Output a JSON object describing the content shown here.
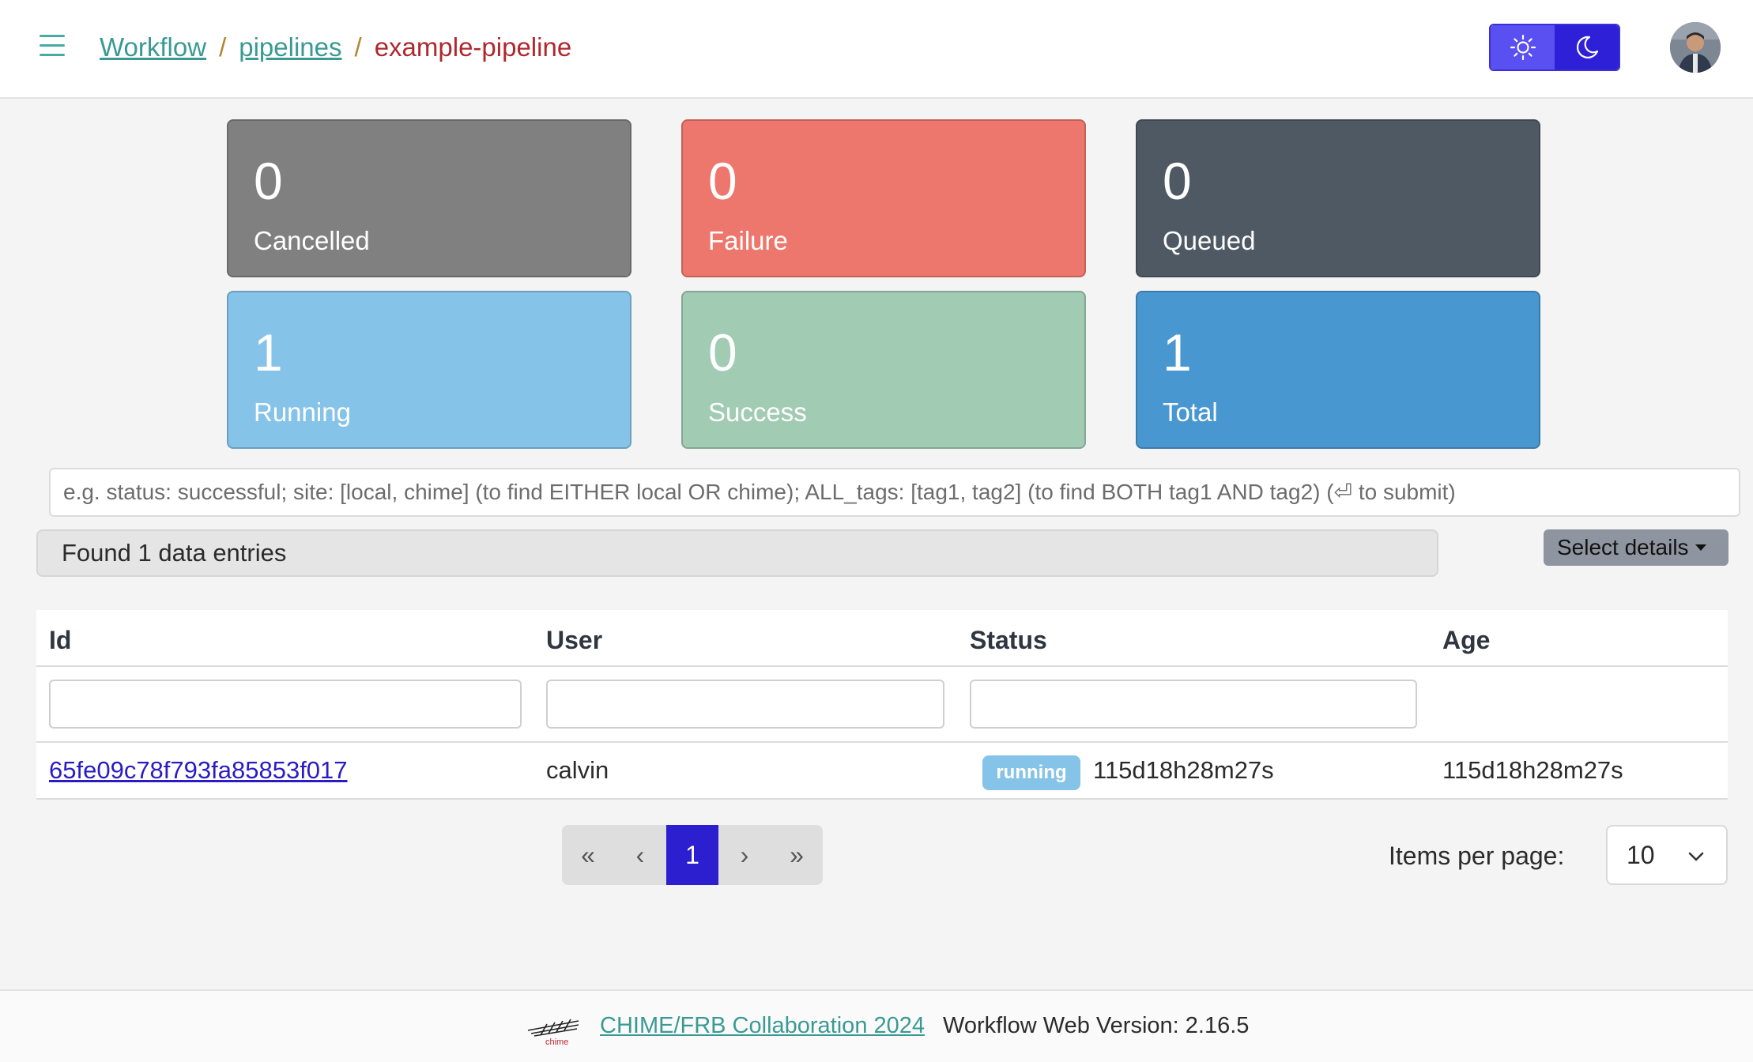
{
  "header": {
    "breadcrumb": [
      {
        "label": "Workflow"
      },
      {
        "label": "pipelines"
      },
      {
        "label": "example-pipeline"
      }
    ],
    "separator": "/",
    "theme_buttons": [
      "sun-icon",
      "moon-icon"
    ]
  },
  "stats": [
    {
      "value": "0",
      "label": "Cancelled",
      "color": "#808080"
    },
    {
      "value": "0",
      "label": "Failure",
      "color": "#ed776c"
    },
    {
      "value": "0",
      "label": "Queued",
      "color": "#4f5964"
    },
    {
      "value": "1",
      "label": "Running",
      "color": "#86c3e8"
    },
    {
      "value": "0",
      "label": "Success",
      "color": "#a2cbb4"
    },
    {
      "value": "1",
      "label": "Total",
      "color": "#4897d0"
    }
  ],
  "search": {
    "placeholder": "e.g. status: successful; site: [local, chime] (to find EITHER local OR chime); ALL_tags: [tag1, tag2] (to find BOTH tag1 AND tag2) (⏎ to submit)",
    "value": ""
  },
  "results": {
    "found_text": "Found 1 data entries",
    "select_details_label": "Select details"
  },
  "table": {
    "columns": [
      "Id",
      "User",
      "Status",
      "Age"
    ],
    "rows": [
      {
        "id": "65fe09c78f793fa85853f017",
        "user": "calvin",
        "status_badge": "running",
        "status_time": "115d18h28m27s",
        "age": "115d18h28m27s"
      }
    ]
  },
  "pagination": {
    "first": "«",
    "prev": "‹",
    "current": "1",
    "next": "›",
    "last": "»",
    "items_per_page_label": "Items per page:",
    "items_per_page": "10"
  },
  "footer": {
    "logo_text": "chime",
    "link_text": "CHIME/FRB Collaboration 2024",
    "version_text": "Workflow Web Version: 2.16.5"
  },
  "colors": {
    "accent": "#3a9a93",
    "primary": "#2b1fcf",
    "crumb_current": "#b0282d"
  }
}
